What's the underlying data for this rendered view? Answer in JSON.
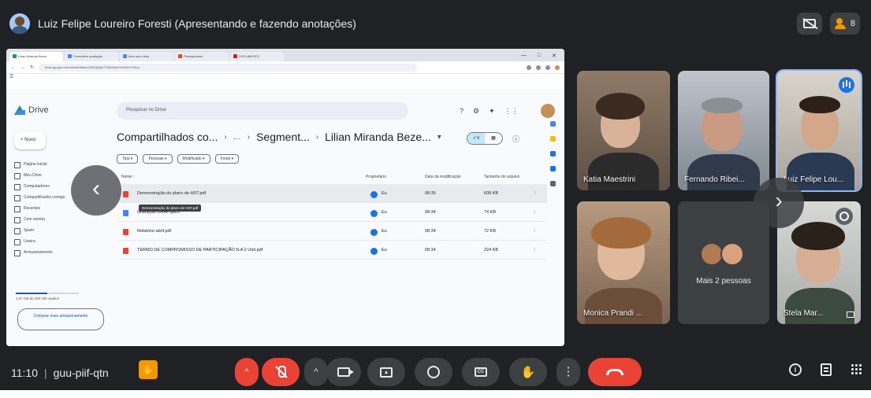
{
  "meet": {
    "presenter_title": "Luiz Felipe Loureiro Foresti (Apresentando e fazendo anotações)",
    "participant_count": "8",
    "meeting_time": "11:10",
    "meeting_code": "guu-piif-qtn"
  },
  "browser": {
    "tabs": [
      "Lilian Miranda Bezer",
      "Formulário avaliação",
      "Item sem título",
      "Planejamento",
      "DOCUMENTO"
    ],
    "url": "drive.google.com/drive/folders/1Wk3jQ9m7T8s0kAeXo4Vb2cYd5Lp",
    "window_controls": [
      "—",
      "□",
      "✕"
    ]
  },
  "drive": {
    "app_name": "Drive",
    "search_placeholder": "Pesquisar no Drive",
    "new_label": "+ Novo",
    "nav": [
      "Página inicial",
      "Meu Drive",
      "Computadores",
      "Compartilhados comigo",
      "Recentes",
      "Com estrela",
      "Spam",
      "Lixeira",
      "Armazenamento"
    ],
    "storage_text": "1,07 GB de 200 GB usados",
    "buy_storage": "Comprar mais armazenamento",
    "breadcrumb": [
      "Compartilhados co...",
      "Segment...",
      "Lilian Miranda Beze..."
    ],
    "filters": [
      "Tipo ▾",
      "Pessoas ▾",
      "Modificado ▾",
      "Fonte ▾"
    ],
    "columns": [
      "Nome ↑",
      "Proprietário",
      "Data da modificação",
      "Tamanho do arquivo"
    ],
    "files": [
      {
        "name": "Demonstração do plano de HST.pdf",
        "owner": "Eu",
        "modified": "08:36",
        "size": "608 KB"
      },
      {
        "name": "Gravação DRAFSplcs",
        "owner": "Eu",
        "modified": "08:34",
        "size": "74 KB"
      },
      {
        "name": "Relatório abril.pdf",
        "owner": "Eu",
        "modified": "08:34",
        "size": "72 KB"
      },
      {
        "name": "TERMO DE COMPROMISSO DE PARTICIPAÇÃO N.A 2 Unit.pdf",
        "owner": "Eu",
        "modified": "08:34",
        "size": "224 KB"
      }
    ],
    "tooltip": "Demonstração do plano de HST.pdf"
  },
  "participants": [
    {
      "name": "Katia Maestrini"
    },
    {
      "name": "Fernando Ribei..."
    },
    {
      "name": "Luiz Felipe Lou..."
    },
    {
      "name": "Monica Prandi ..."
    },
    {
      "name": "Mais 2 pessoas"
    },
    {
      "name": "Stela Mar..."
    }
  ],
  "colors": {
    "meet_bg": "#202124",
    "end_call": "#ea4335",
    "mic_off": "#ea4335",
    "hand_raised": "#f29900",
    "speaking_border": "#8ab4f8"
  },
  "icons": {
    "back": "‹",
    "next": "›",
    "caret": "^"
  }
}
